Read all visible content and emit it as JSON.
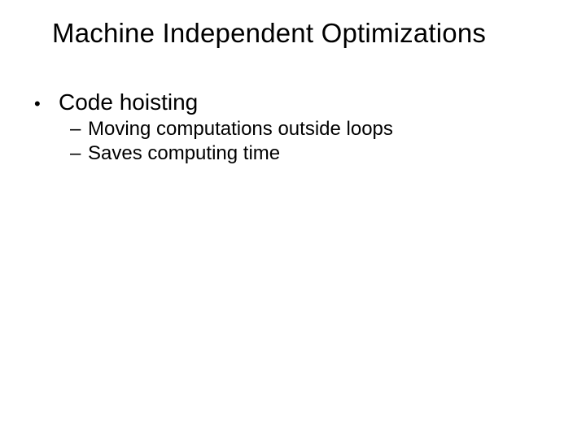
{
  "title": "Machine Independent Optimizations",
  "bullets": {
    "item1": {
      "label": "Code hoisting",
      "sub1": "Moving computations outside loops",
      "sub2": "Saves computing time"
    }
  },
  "glyphs": {
    "disc": "•",
    "dash": "–"
  }
}
